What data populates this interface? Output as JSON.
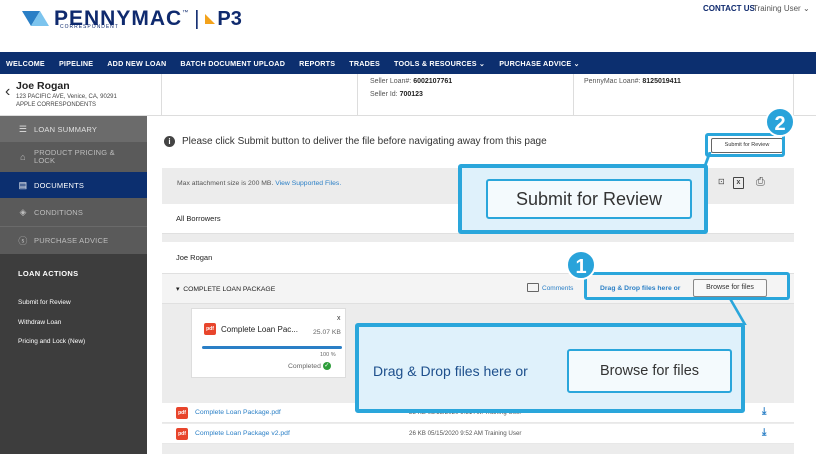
{
  "header": {
    "logo_text": "PENNYMAC",
    "logo_tm": "™",
    "logo_sub": "CORRESPONDENT",
    "logo_separator": "|",
    "p3_text": "P3",
    "contact": "CONTACT US",
    "user": "Training User ⌄"
  },
  "nav": {
    "items": [
      "WELCOME",
      "PIPELINE",
      "ADD NEW LOAN",
      "BATCH DOCUMENT UPLOAD",
      "REPORTS",
      "TRADES",
      "TOOLS & RESOURCES ⌄",
      "PURCHASE ADVICE ⌄"
    ]
  },
  "borrower": {
    "name": "Joe Rogan",
    "address": "123 PACIFIC AVE, Venice, CA, 90291",
    "company": "APPLE CORRESPONDENTS",
    "seller_loan_label": "Seller Loan#:",
    "seller_loan": "6002107761",
    "seller_id_label": "Seller Id:",
    "seller_id": "700123",
    "pm_loan_label": "PennyMac Loan#:",
    "pm_loan": "8125019411"
  },
  "sidebar": {
    "items": [
      "LOAN SUMMARY",
      "PRODUCT PRICING & LOCK",
      "DOCUMENTS",
      "CONDITIONS",
      "PURCHASE ADVICE"
    ],
    "actions_title": "LOAN ACTIONS",
    "actions": [
      "Submit for Review",
      "Withdraw Loan",
      "Pricing and Lock (New)"
    ]
  },
  "main": {
    "alert": "Please click Submit button to deliver the file before navigating away from this page",
    "submit_label": "Submit for Review",
    "max_attach": "Max attachment size is 200 MB.",
    "supported_link": "View Supported Files.",
    "all_borrowers": "All Borrowers",
    "borrower_name": "Joe Rogan",
    "package_title": "COMPLETE LOAN PACKAGE",
    "comments": "Comments",
    "drag_drop": "Drag & Drop files here or",
    "browse": "Browse for files",
    "upload": {
      "name": "Complete Loan Pac...",
      "size": "25.07 KB",
      "progress_pct": "100 %",
      "progress_fraction": 1.0,
      "status": "Completed",
      "close": "x"
    },
    "files": [
      {
        "name": "Complete Loan Package.pdf",
        "meta": "25 KB  05/15/2020 9:51 AM  Training User"
      },
      {
        "name": "Complete Loan Package v2.pdf",
        "meta": "26 KB  05/15/2020 9:52 AM  Training User"
      }
    ]
  },
  "callouts": {
    "badge1": "1",
    "badge2": "2",
    "zoom_submit": "Submit for Review",
    "zoom_drag": "Drag & Drop files here or",
    "zoom_browse": "Browse for files"
  },
  "colors": {
    "nav_bg": "#0c2f6f",
    "accent": "#2aa6db",
    "link": "#2a7fc6",
    "sidebar_bg": "#3d3d3d"
  }
}
